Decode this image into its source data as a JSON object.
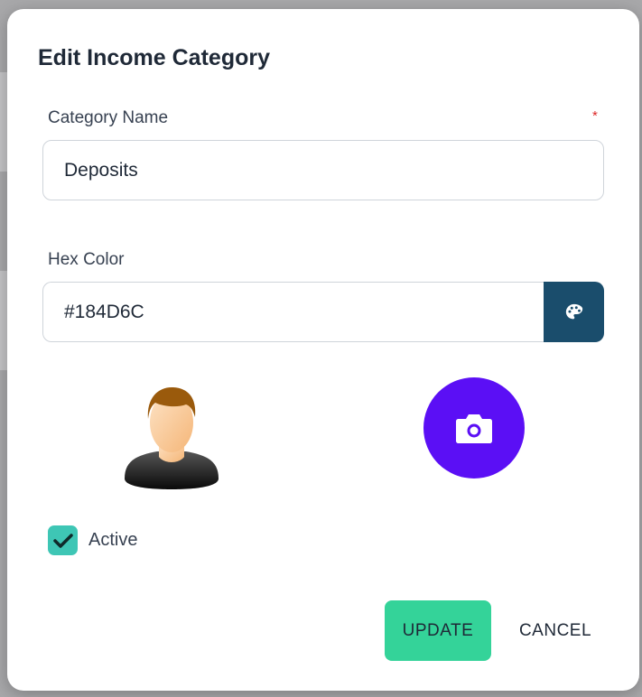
{
  "dialog": {
    "title": "Edit Income Category"
  },
  "category_name": {
    "label": "Category Name",
    "required_mark": "*",
    "value": "Deposits"
  },
  "hex_color": {
    "label": "Hex Color",
    "value": "#184D6C",
    "picker_icon": "palette-icon"
  },
  "media": {
    "avatar": "person-avatar",
    "upload_icon": "camera-icon"
  },
  "active": {
    "label": "Active",
    "checked": true
  },
  "actions": {
    "update_label": "UPDATE",
    "cancel_label": "CANCEL"
  },
  "colors": {
    "accent_primary": "#1a4d6c",
    "upload_button": "#5b0ff5",
    "update_button": "#34d399",
    "checkbox": "#3ec6b5",
    "required": "#dc2626"
  }
}
